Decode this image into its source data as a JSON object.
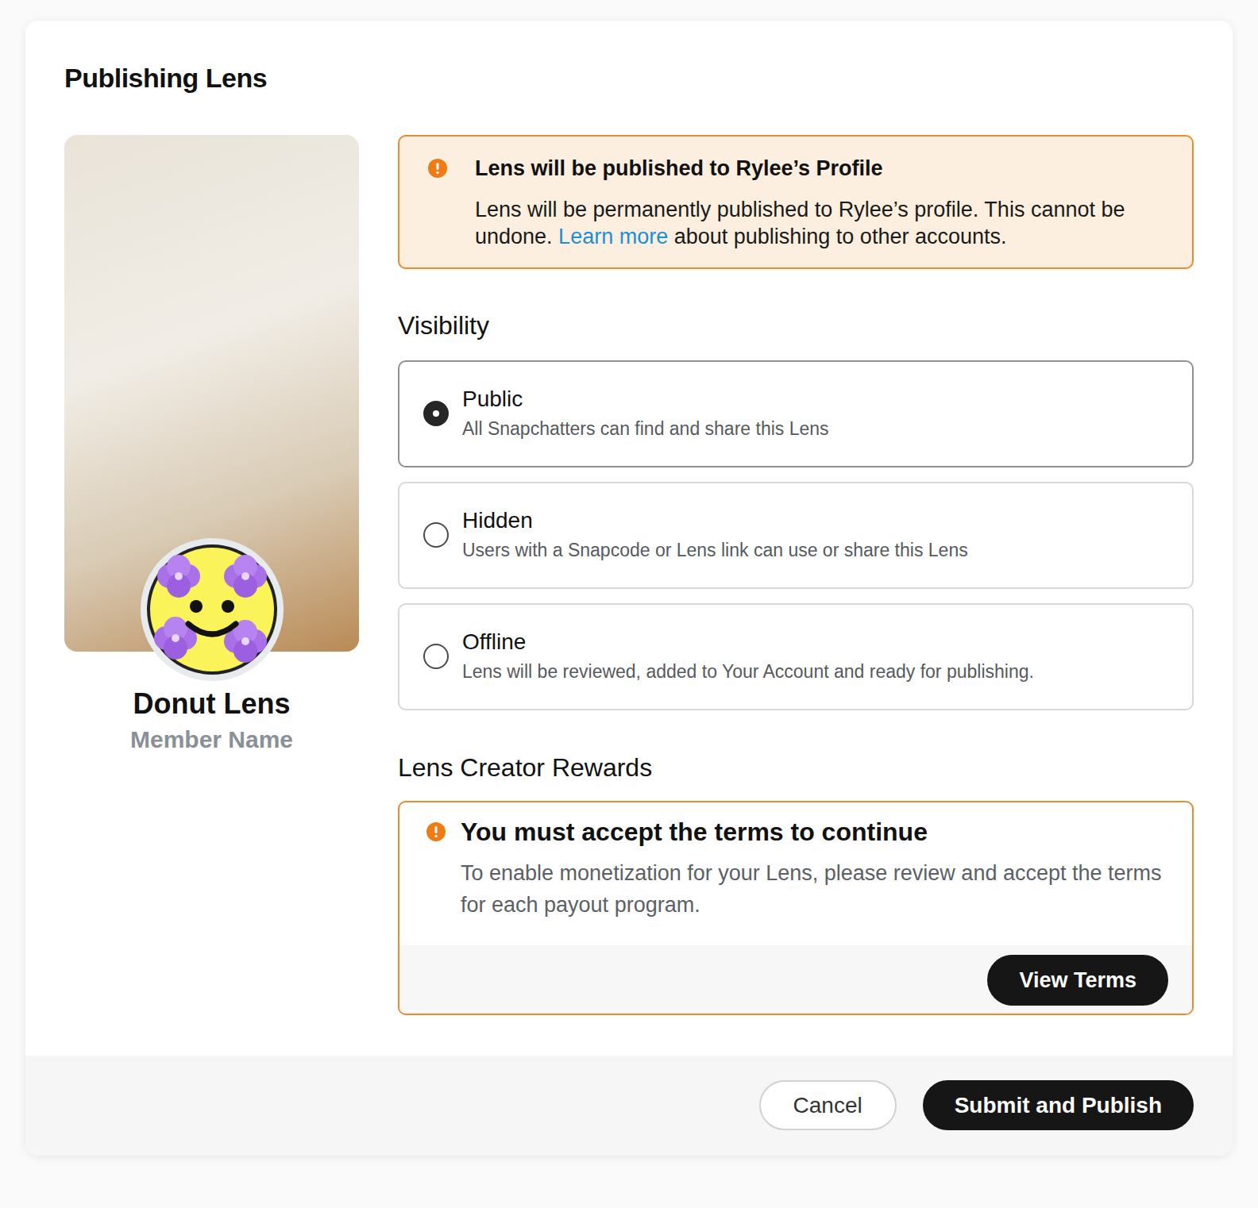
{
  "dialog": {
    "title": "Publishing Lens"
  },
  "lens": {
    "name": "Donut Lens",
    "member": "Member Name"
  },
  "notice": {
    "title": "Lens will be published to Rylee’s Profile",
    "text_before": "Lens will be permanently published to Rylee’s profile. This cannot be undone. ",
    "link": "Learn more",
    "text_after": " about publishing to other accounts."
  },
  "visibility": {
    "heading": "Visibility",
    "options": [
      {
        "title": "Public",
        "description": "All Snapchatters can find and share this Lens",
        "selected": true
      },
      {
        "title": "Hidden",
        "description": "Users with a Snapcode or Lens link can use or share this Lens",
        "selected": false
      },
      {
        "title": "Offline",
        "description": "Lens will be reviewed, added to Your Account and ready for publishing.",
        "selected": false
      }
    ]
  },
  "rewards": {
    "heading": "Lens Creator Rewards",
    "title": "You must accept the terms to continue",
    "text": "To enable monetization for your Lens, please review and accept the terms for each payout program.",
    "button": "View Terms"
  },
  "buttons": [
    {
      "label": "Cancel",
      "kind": "secondary"
    },
    {
      "label": "Submit and Publish",
      "kind": "primary"
    }
  ]
}
